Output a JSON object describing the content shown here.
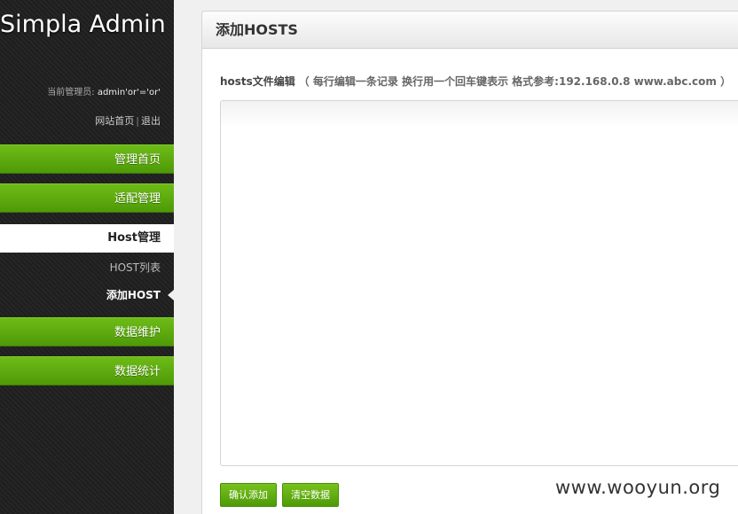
{
  "sidebar": {
    "title": "Simpla Admin",
    "admin_prefix": "当前管理员: ",
    "admin_name": "admin'or'='or'",
    "link_home": "网站首页",
    "link_sep": "|",
    "link_logout": "退出",
    "nav": [
      {
        "label": "管理首页"
      },
      {
        "label": "适配管理"
      },
      {
        "label": "Host管理"
      },
      {
        "label": "数据维护"
      },
      {
        "label": "数据统计"
      }
    ],
    "sub_nav": [
      {
        "label": "HOST列表"
      },
      {
        "label": "添加HOST"
      }
    ]
  },
  "panel": {
    "title": "添加HOSTS",
    "field_label": "hosts文件编辑",
    "field_hint": "（ 每行编辑一条记录 换行用一个回车键表示 格式参考:192.168.0.8 www.abc.com ）",
    "textarea_value": ""
  },
  "buttons": {
    "confirm": "确认添加",
    "clear": "清空数据"
  },
  "watermark": "www.wooyun.org",
  "colors": {
    "accent_green": "#5fae0f",
    "sidebar_bg": "#222222"
  }
}
